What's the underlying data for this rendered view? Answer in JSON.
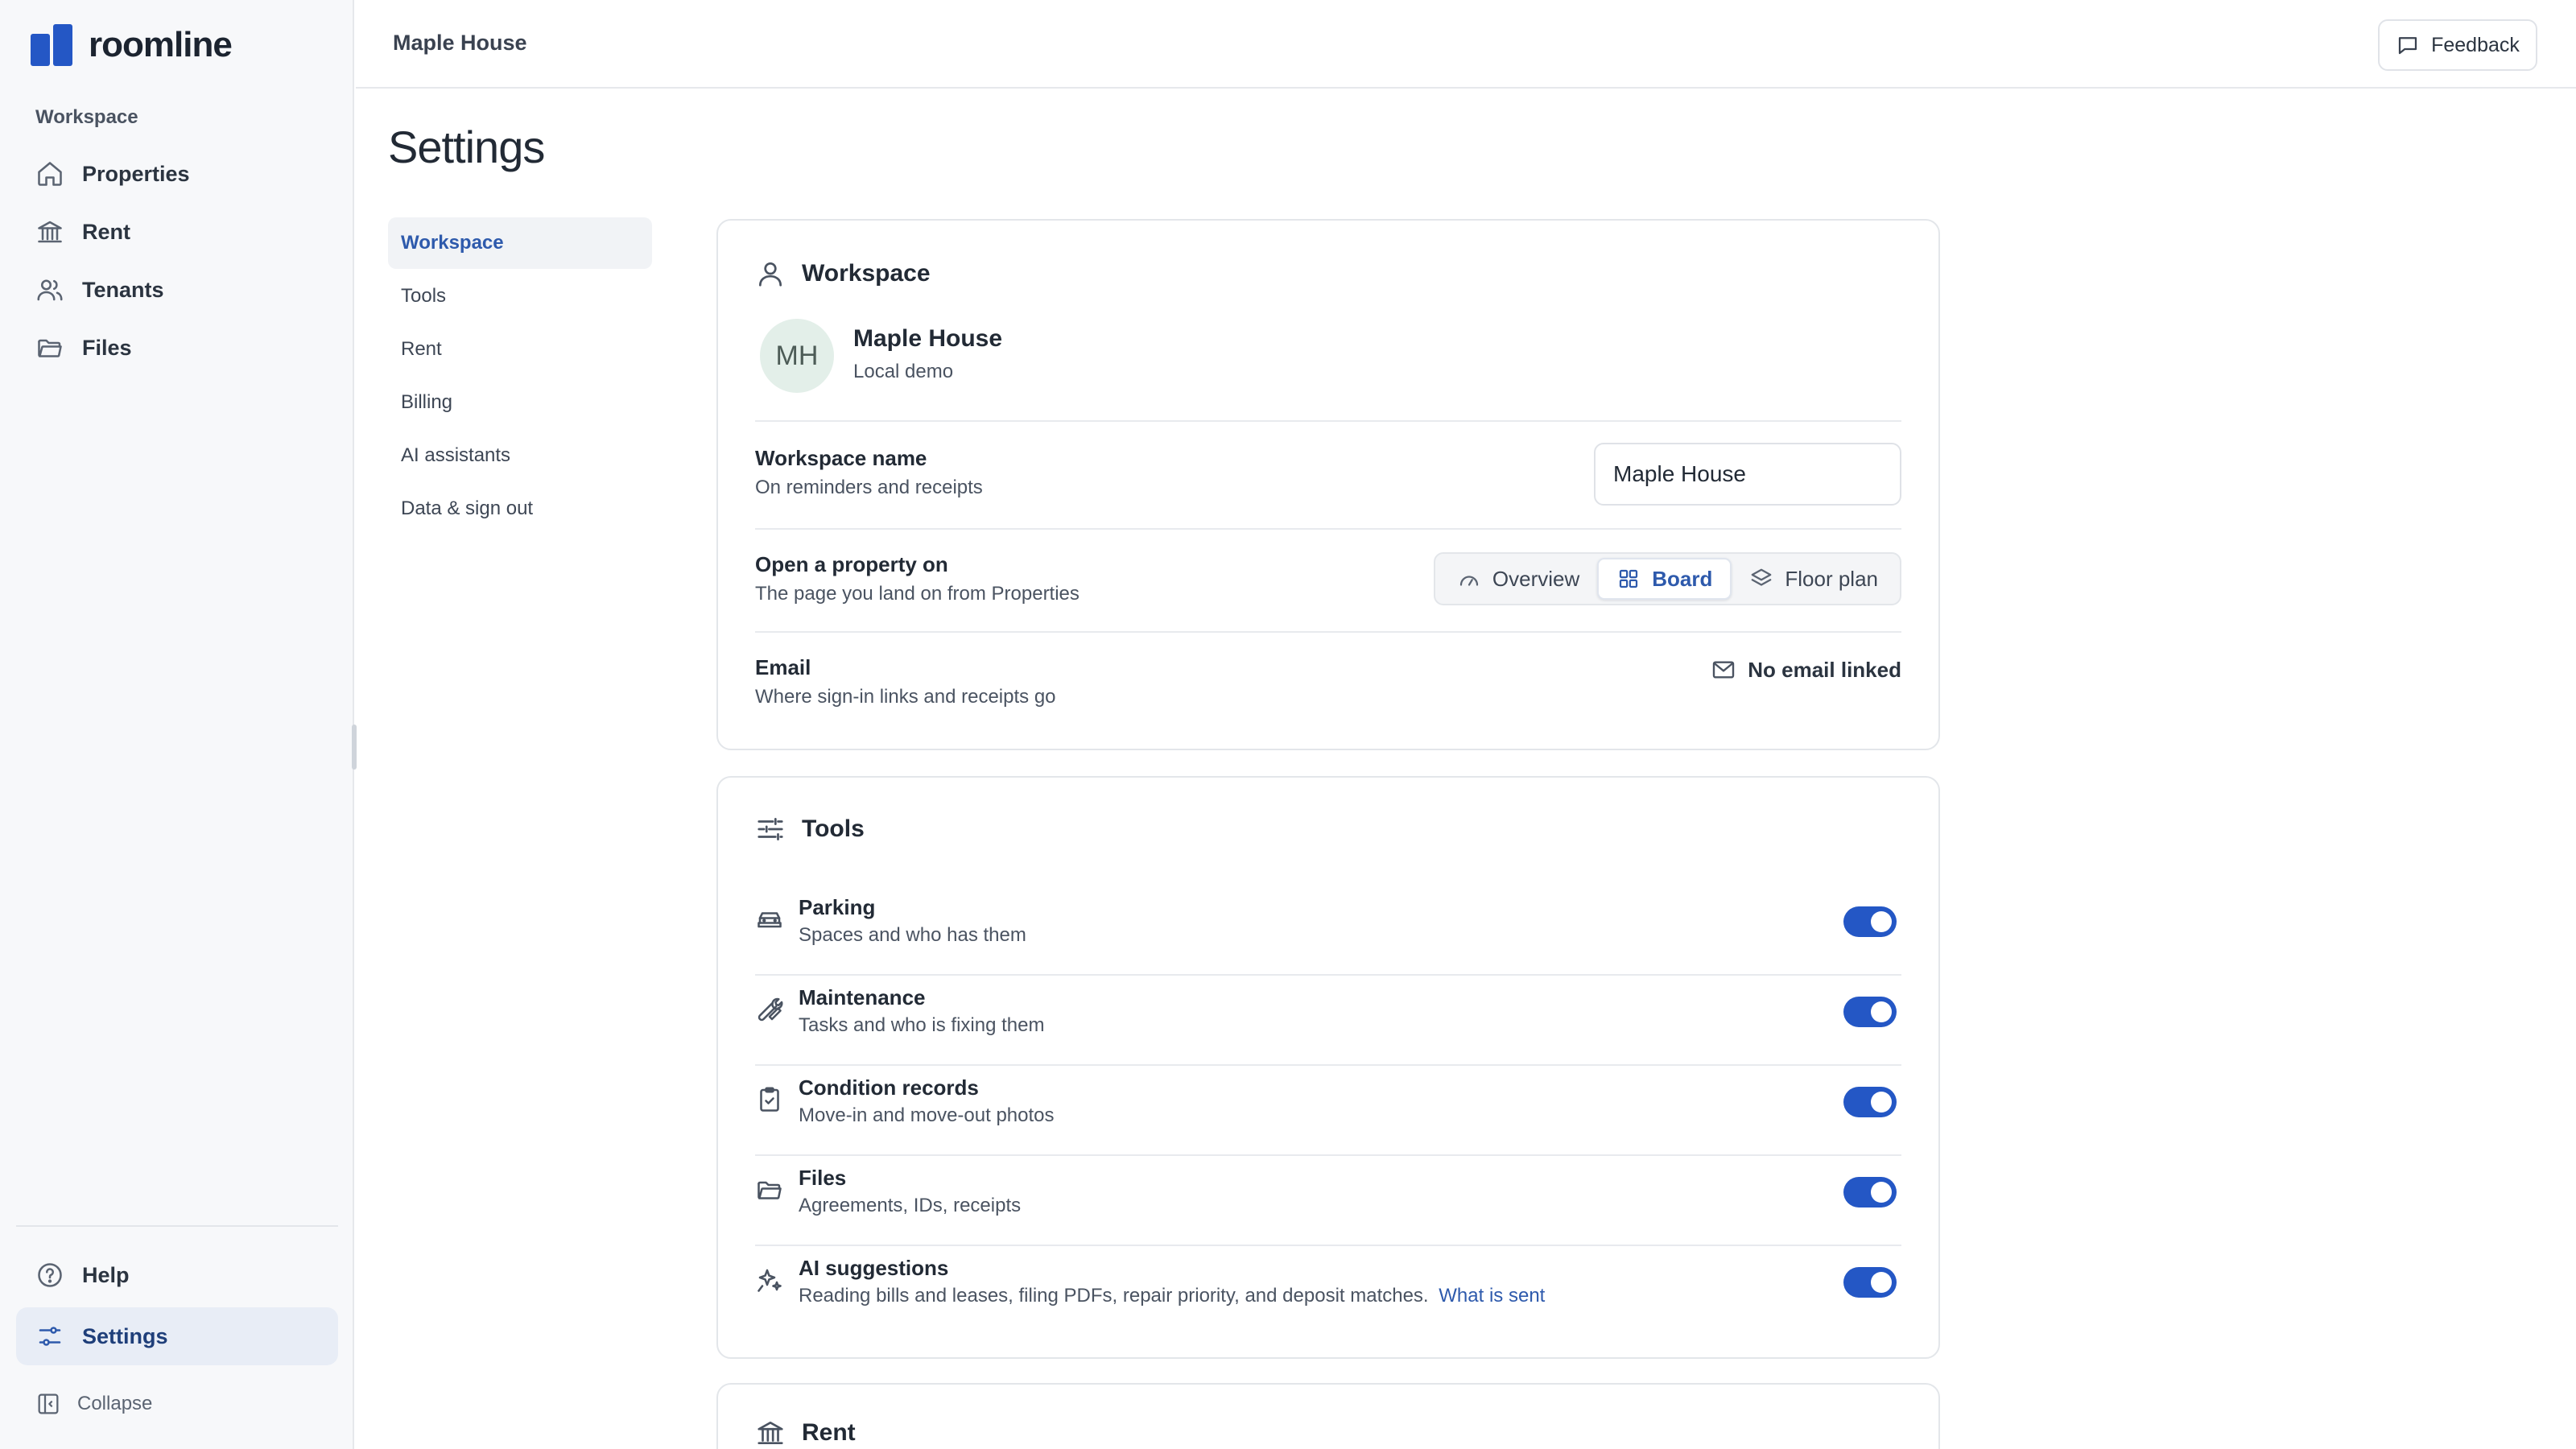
{
  "brand": {
    "name": "roomline"
  },
  "sidebar": {
    "section_label": "Workspace",
    "items": [
      {
        "label": "Properties",
        "icon": "home-icon"
      },
      {
        "label": "Rent",
        "icon": "bank-icon"
      },
      {
        "label": "Tenants",
        "icon": "users-icon"
      },
      {
        "label": "Files",
        "icon": "folder-icon"
      }
    ],
    "bottom_items": [
      {
        "label": "Help",
        "icon": "help-icon"
      },
      {
        "label": "Settings",
        "icon": "settings-icon",
        "active": true
      }
    ],
    "collapse_label": "Collapse"
  },
  "topbar": {
    "breadcrumb": "Maple House",
    "feedback_label": "Feedback"
  },
  "page": {
    "title": "Settings",
    "subnav": [
      {
        "label": "Workspace",
        "active": true
      },
      {
        "label": "Tools"
      },
      {
        "label": "Rent"
      },
      {
        "label": "Billing"
      },
      {
        "label": "AI assistants"
      },
      {
        "label": "Data & sign out"
      }
    ]
  },
  "workspace_card": {
    "heading": "Workspace",
    "avatar_initials": "MH",
    "name": "Maple House",
    "subtitle": "Local demo",
    "name_field": {
      "label": "Workspace name",
      "description": "On reminders and receipts",
      "value": "Maple House"
    },
    "open_property": {
      "label": "Open a property on",
      "description": "The page you land on from Properties",
      "options": [
        "Overview",
        "Board",
        "Floor plan"
      ],
      "selected": "Board"
    },
    "email": {
      "label": "Email",
      "description": "Where sign-in links and receipts go",
      "status": "No email linked"
    }
  },
  "tools_card": {
    "heading": "Tools",
    "items": [
      {
        "label": "Parking",
        "description": "Spaces and who has them",
        "icon": "car-icon",
        "enabled": true
      },
      {
        "label": "Maintenance",
        "description": "Tasks and who is fixing them",
        "icon": "wrench-icon",
        "enabled": true
      },
      {
        "label": "Condition records",
        "description": "Move-in and move-out photos",
        "icon": "clipboard-check-icon",
        "enabled": true
      },
      {
        "label": "Files",
        "description": "Agreements, IDs, receipts",
        "icon": "folder-icon",
        "enabled": true
      },
      {
        "label": "AI suggestions",
        "description": "Reading bills and leases, filing PDFs, repair priority, and deposit matches.",
        "link": "What is sent",
        "icon": "sparkles-icon",
        "enabled": true
      }
    ]
  },
  "rent_card": {
    "heading": "Rent"
  },
  "colors": {
    "accent": "#2457c5",
    "link": "#2e5aac",
    "sidebar_bg": "#f7f8fa",
    "active_bg": "#e8edf6"
  }
}
